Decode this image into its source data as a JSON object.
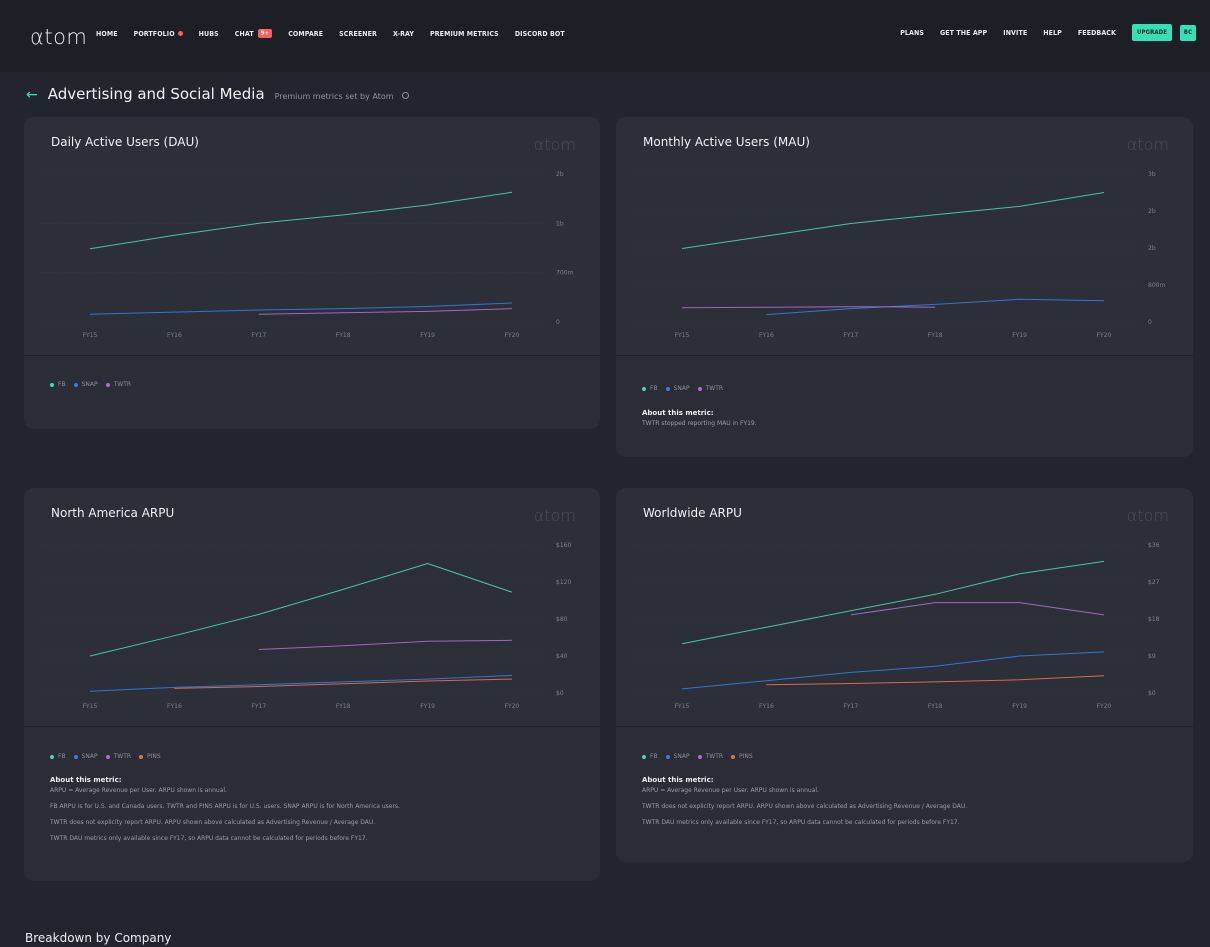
{
  "nav": {
    "logo": "αtom",
    "left_items": [
      "HOME",
      "PORTFOLIO",
      "HUBS",
      "CHAT",
      "COMPARE",
      "SCREENER",
      "X-RAY",
      "PREMIUM METRICS",
      "DISCORD BOT"
    ],
    "chat_badge": "9+",
    "right_items": [
      "PLANS",
      "GET THE APP",
      "INVITE",
      "HELP",
      "FEEDBACK"
    ],
    "upgrade_label": "UPGRADE",
    "avatar_initials": "BC"
  },
  "page": {
    "title": "Advertising and Social Media",
    "subtitle": "Premium metrics set by Atom",
    "section_title": "Breakdown by Company"
  },
  "colors": {
    "FB": "#4ad6b0",
    "SNAP": "#2f7fe3",
    "TWTR": "#b36bd6",
    "PINS": "#f26b4b"
  },
  "cards": [
    {
      "title": "Daily Active Users (DAU)",
      "logo": "αtom",
      "legend": [
        "FB",
        "SNAP",
        "TWTR"
      ],
      "about_title": "",
      "about": []
    },
    {
      "title": "Monthly Active Users (MAU)",
      "logo": "αtom",
      "legend": [
        "FB",
        "SNAP",
        "TWTR"
      ],
      "about_title": "About this metric:",
      "about": [
        "TWTR stopped reporting MAU in FY19."
      ]
    },
    {
      "title": "North America ARPU",
      "logo": "αtom",
      "legend": [
        "FB",
        "SNAP",
        "TWTR",
        "PINS"
      ],
      "about_title": "About this metric:",
      "about": [
        "ARPU = Average Revenue per User. ARPU shown is annual.",
        "FB ARPU is for U.S. and Canada users. TWTR and PINS ARPU is for U.S. users. SNAP ARPU is for North America users.",
        "TWTR does not explicity report ARPU. ARPU shown above calculated as Advertising Revenue / Average DAU.",
        "TWTR DAU metrics only available since FY17, so ARPU data cannot be calculated for periods before FY17."
      ]
    },
    {
      "title": "Worldwide ARPU",
      "logo": "αtom",
      "legend": [
        "FB",
        "SNAP",
        "TWTR",
        "PINS"
      ],
      "about_title": "About this metric:",
      "about": [
        "ARPU = Average Revenue per User. ARPU shown is annual.",
        "TWTR does not explicity report ARPU. ARPU shown above calculated as Advertising Revenue / Average DAU.",
        "TWTR DAU metrics only available since FY17, so ARPU data cannot be calculated for periods before FY17."
      ]
    }
  ],
  "chart_data": [
    {
      "type": "line",
      "title": "Daily Active Users (DAU)",
      "x": [
        "FY15",
        "FY16",
        "FY17",
        "FY18",
        "FY19",
        "FY20"
      ],
      "y_ticks": [
        "0",
        "700m",
        "1b",
        "2b"
      ],
      "y_tick_values": [
        0,
        0.7,
        1.4,
        2.1
      ],
      "ylim": [
        0,
        2.1
      ],
      "grid": true,
      "legend_position": "bottom-left",
      "series": [
        {
          "name": "FB",
          "values": [
            1.04,
            1.23,
            1.4,
            1.52,
            1.66,
            1.84
          ]
        },
        {
          "name": "SNAP",
          "values": [
            0.11,
            0.14,
            0.17,
            0.19,
            0.22,
            0.27
          ]
        },
        {
          "name": "TWTR",
          "values": [
            null,
            null,
            0.11,
            0.13,
            0.15,
            0.19
          ]
        }
      ]
    },
    {
      "type": "line",
      "title": "Monthly Active Users (MAU)",
      "x": [
        "FY15",
        "FY16",
        "FY17",
        "FY18",
        "FY19",
        "FY20"
      ],
      "y_ticks": [
        "0",
        "800m",
        "2b",
        "2b",
        "3b"
      ],
      "y_tick_values": [
        0,
        0.8,
        1.6,
        2.4,
        3.2
      ],
      "ylim": [
        0,
        3.2
      ],
      "grid": true,
      "legend_position": "bottom-left",
      "series": [
        {
          "name": "FB",
          "values": [
            1.59,
            1.86,
            2.13,
            2.32,
            2.5,
            2.8
          ]
        },
        {
          "name": "SNAP",
          "values": [
            null,
            0.16,
            0.29,
            0.38,
            0.49,
            0.46
          ]
        },
        {
          "name": "TWTR",
          "values": [
            0.31,
            0.32,
            0.33,
            0.32,
            null,
            null
          ]
        }
      ]
    },
    {
      "type": "line",
      "title": "North America ARPU",
      "x": [
        "FY15",
        "FY16",
        "FY17",
        "FY18",
        "FY19",
        "FY20"
      ],
      "y_ticks": [
        "$0",
        "$40",
        "$80",
        "$120",
        "$160"
      ],
      "y_tick_values": [
        0,
        40,
        80,
        120,
        160
      ],
      "ylim": [
        0,
        160
      ],
      "grid": true,
      "legend_position": "bottom-left",
      "series": [
        {
          "name": "FB",
          "values": [
            40,
            62,
            85,
            112,
            140,
            109
          ]
        },
        {
          "name": "SNAP",
          "values": [
            2,
            6,
            9,
            12,
            15,
            19
          ]
        },
        {
          "name": "TWTR",
          "values": [
            null,
            null,
            47,
            51,
            56,
            57
          ]
        },
        {
          "name": "PINS",
          "values": [
            null,
            5,
            7,
            10,
            13,
            15
          ]
        }
      ]
    },
    {
      "type": "line",
      "title": "Worldwide ARPU",
      "x": [
        "FY15",
        "FY16",
        "FY17",
        "FY18",
        "FY19",
        "FY20"
      ],
      "y_ticks": [
        "$0",
        "$9",
        "$18",
        "$27",
        "$36"
      ],
      "y_tick_values": [
        0,
        9,
        18,
        27,
        36
      ],
      "ylim": [
        0,
        36
      ],
      "grid": true,
      "legend_position": "bottom-left",
      "series": [
        {
          "name": "FB",
          "values": [
            12,
            16,
            20,
            24,
            29,
            32
          ]
        },
        {
          "name": "SNAP",
          "values": [
            1,
            3,
            5,
            6.5,
            9,
            10
          ]
        },
        {
          "name": "TWTR",
          "values": [
            null,
            null,
            19,
            22,
            22,
            19
          ]
        },
        {
          "name": "PINS",
          "values": [
            null,
            2,
            2.3,
            2.7,
            3.2,
            4.2
          ]
        }
      ]
    }
  ]
}
